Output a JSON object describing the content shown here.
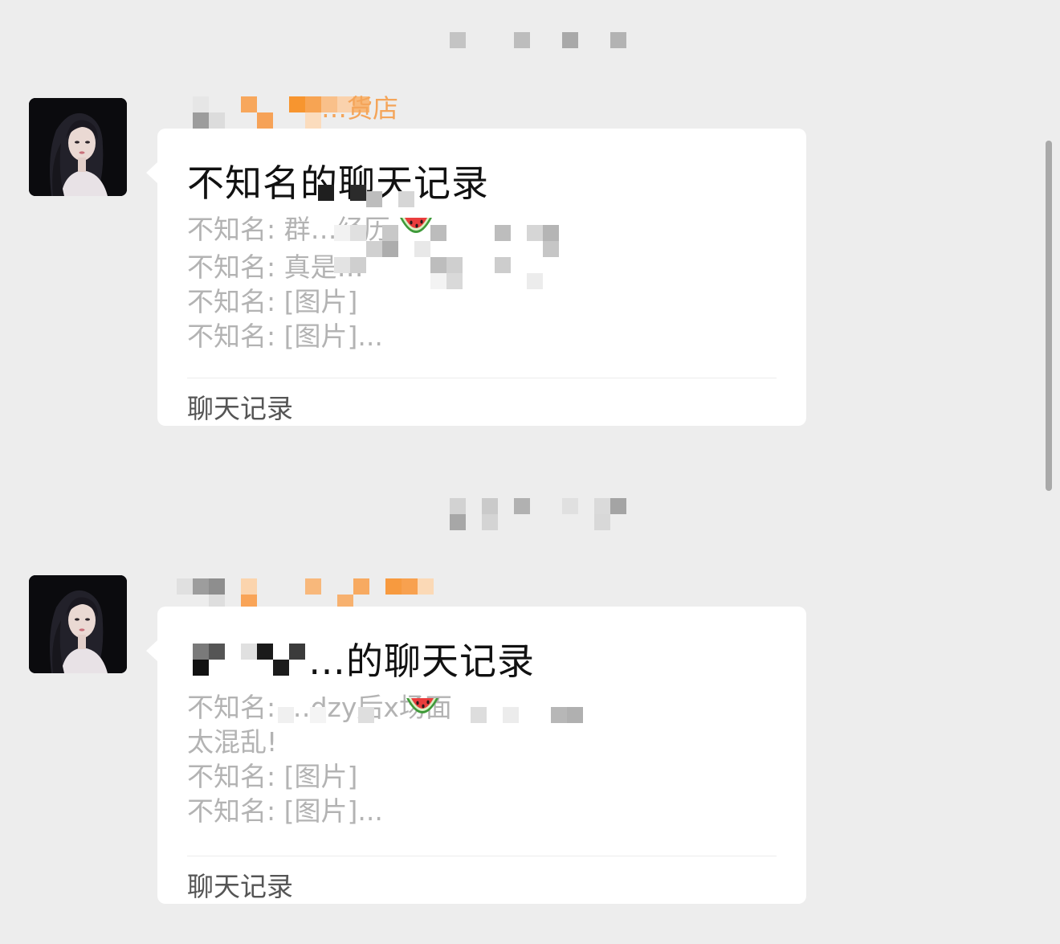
{
  "messages": [
    {
      "sender_name": "…货店",
      "card": {
        "title": "不知名的聊天记录",
        "lines": [
          "不知名: 群…经历",
          "不知名: 真是…",
          "不知名: [图片]",
          "不知名: [图片]..."
        ],
        "footer": "聊天记录"
      }
    },
    {
      "sender_name": "",
      "card": {
        "title": "…的聊天记录",
        "lines": [
          "不知名: …dzy后x场面",
          "太混乱!",
          "不知名: [图片]",
          "不知名: [图片]..."
        ],
        "footer": "聊天记录"
      }
    }
  ],
  "emoji": "watermelon",
  "colors": {
    "background": "#ededed",
    "bubble": "#ffffff",
    "sender_name": "#f4a55a",
    "preview_text": "#b3b3b3",
    "footer_text": "#555555"
  }
}
